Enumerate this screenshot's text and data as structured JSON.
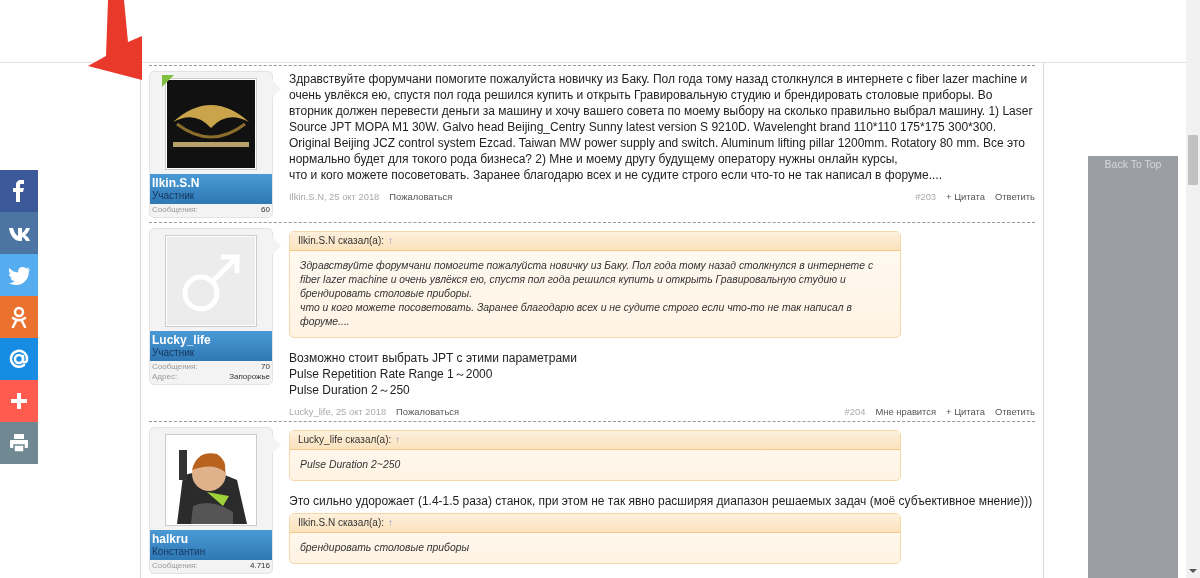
{
  "share_bar": [
    {
      "kind": "facebook"
    },
    {
      "kind": "vk"
    },
    {
      "kind": "twitter"
    },
    {
      "kind": "odnoklassniki"
    },
    {
      "kind": "mail"
    },
    {
      "kind": "more"
    },
    {
      "kind": "print"
    }
  ],
  "posts": [
    {
      "author": "Ilkin.S.N",
      "role": "Участник",
      "avatar": {
        "kind": "picture"
      },
      "online": true,
      "stats": [
        {
          "label": "Сообщения:",
          "value": "60"
        }
      ],
      "blocks": [
        {
          "kind": "text",
          "paragraphs": [
            "Здравствуйте форумчани помогите пожалуйста новичку из Баку. Пол года тому назад столкнулся в интернете с fiber lazer machine и очень увлёкся ею, спустя пол года решился купить и открыть Гравировальную студию и брендировать столовые приборы. Во вторник должен перевести деньги за машину и хочу вашего совета по моему выбору на сколько правильно выбрал машину. 1) Laser Source JPT MOPA M1 30W. Galvo head Beijing_Centry Sunny latest version S 9210D. Wavelenght brand 110*110 175*175 300*300. Original Beijing JCZ control system Ezcad. Taiwan MW power supply and switch. Aluminum lifting pillar 1200mm. Rotatory 80 mm. Все это нормально будет для токого рода бизнеса? 2) Мне и моему другу будущему оператору нужны онлайн курсы,",
            "что и кого можете посоветовать. Заранее благодарю всех и не судите строго если что-то не так написал в форуме...."
          ]
        }
      ],
      "footer": {
        "byline": "Ilkin.S.N, 25 окт 2018",
        "report": "Пожаловаться",
        "number": "#203",
        "actions": [
          "+ Цитата",
          "Ответить"
        ]
      }
    },
    {
      "author": "Lucky_life",
      "role": "Участник",
      "avatar": {
        "kind": "picture"
      },
      "online": false,
      "stats": [
        {
          "label": "Сообщения:",
          "value": "70"
        },
        {
          "label": "Адрес:",
          "value": "Запорожье"
        }
      ],
      "blocks": [
        {
          "kind": "quote",
          "author": "Ilkin.S.N сказал(а):",
          "arrow": "↑",
          "paragraphs": [
            "Здравствуйте форумчани помогите пожалуйста новичку из Баку. Пол года тому назад столкнулся в интернете с fiber lazer machine и очень увлёкся ею, спустя пол года решился купить и открыть Гравировальную студию и брендировать столовые приборы.",
            "что и кого можете посоветовать. Заранее благодарю всех и не судите строго если что-то не так написал в форуме...."
          ]
        },
        {
          "kind": "text",
          "paragraphs": [
            "Возможно стоит выбрать JPT с этими параметрами",
            "Pulse Repetition Rate Range 1～2000",
            "Pulse Duration 2～250"
          ]
        }
      ],
      "footer": {
        "byline": "Lucky_life, 25 окт 2018",
        "report": "Пожаловаться",
        "number": "#204",
        "actions": [
          "Мне нравится",
          "+ Цитата",
          "Ответить"
        ]
      }
    },
    {
      "author": "halkru",
      "role": "Константин",
      "avatar": {
        "kind": "picture"
      },
      "online": false,
      "stats": [
        {
          "label": "Сообщения:",
          "value": "4.716"
        }
      ],
      "blocks": [
        {
          "kind": "quote",
          "author": "Lucky_life сказал(а):",
          "arrow": "↑",
          "paragraphs": [
            "Pulse Duration 2~250"
          ]
        },
        {
          "kind": "text",
          "paragraphs": [
            "Это сильно удорожает (1.4-1.5 раза) станок, при этом не так явно расширяя диапазон решаемых задач (моё субъективное мнение)))"
          ]
        },
        {
          "kind": "quote",
          "author": "Ilkin.S.N сказал(а):",
          "arrow": "↑",
          "paragraphs": [
            "брендировать столовые приборы"
          ]
        }
      ]
    }
  ],
  "back_to_top": "Back To Top"
}
